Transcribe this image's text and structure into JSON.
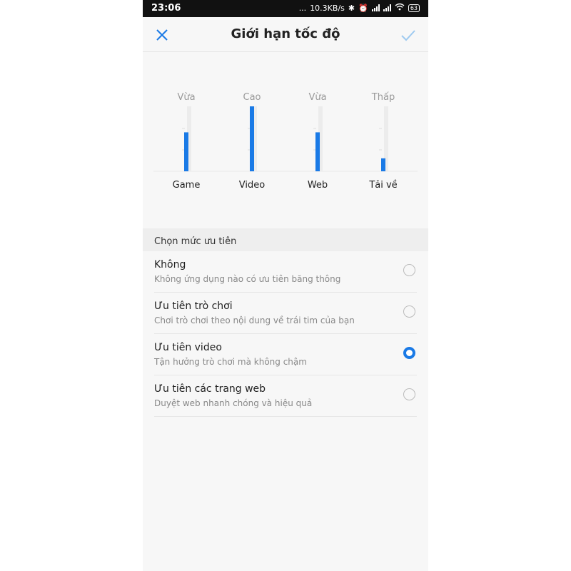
{
  "status_bar": {
    "time": "23:06",
    "dots": "...",
    "speed": "10.3KB/s",
    "battery": "63"
  },
  "header": {
    "title": "Giới hạn tốc độ"
  },
  "chart_data": {
    "type": "bar",
    "categories": [
      "Game",
      "Video",
      "Web",
      "Tải về"
    ],
    "level_labels": [
      "Vừa",
      "Cao",
      "Vừa",
      "Thấp"
    ],
    "values": [
      0.6,
      1.0,
      0.6,
      0.2
    ],
    "ylim": [
      0,
      1
    ],
    "bar_color": "#1a7ae6",
    "track_color": "#ececec"
  },
  "section": {
    "title": "Chọn mức ưu tiên"
  },
  "options": [
    {
      "title": "Không",
      "subtitle": "Không ứng dụng nào có ưu tiên băng thông",
      "selected": false
    },
    {
      "title": "Ưu tiên trò chơi",
      "subtitle": "Chơi trò chơi theo nội dung về trái tim của bạn",
      "selected": false
    },
    {
      "title": "Ưu tiên video",
      "subtitle": "Tận hưởng trò chơi mà không chậm",
      "selected": true
    },
    {
      "title": "Ưu tiên các trang web",
      "subtitle": "Duyệt web nhanh chóng và hiệu quả",
      "selected": false
    }
  ],
  "colors": {
    "accent": "#1a7ae6",
    "check_disabled": "#9ecaf0"
  }
}
